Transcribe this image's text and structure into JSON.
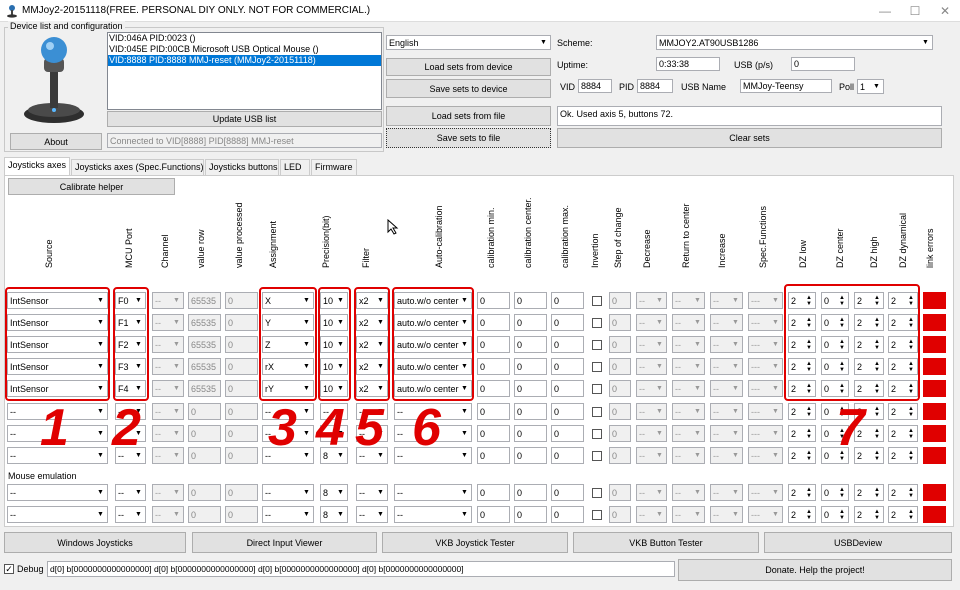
{
  "window": {
    "title": "MMJoy2-20151118(FREE. PERSONAL DIY ONLY. NOT FOR COMMERCIAL.)",
    "min": "—",
    "max": "☐",
    "close": "✕"
  },
  "device_group": {
    "label": "Device list and configuration",
    "devices": [
      "VID:046A PID:0023 ()",
      "VID:045E PID:00CB Microsoft USB Optical Mouse ()",
      "VID:8888 PID:8888 MMJ-reset (MMJoy2-20151118)"
    ],
    "selected": 2,
    "update_usb": "Update USB list",
    "about": "About",
    "status": "Connected to VID[8888] PID[8888] MMJ-reset"
  },
  "language": {
    "value": "English"
  },
  "buttons": {
    "load_device": "Load sets from device",
    "save_device": "Save sets to device",
    "load_file": "Load sets from file",
    "save_file": "Save sets to file",
    "clear": "Clear sets"
  },
  "scheme": {
    "label": "Scheme:",
    "value": "MMJOY2.AT90USB1286"
  },
  "uptime": {
    "label": "Uptime:",
    "value": "0:33:38"
  },
  "usbps": {
    "label": "USB (p/s)",
    "value": "0"
  },
  "vid": {
    "label": "VID",
    "value": "8884"
  },
  "pid": {
    "label": "PID",
    "value": "8884"
  },
  "usbname": {
    "label": "USB Name",
    "value": "MMJoy-Teensy"
  },
  "poll": {
    "label": "Poll",
    "value": "1"
  },
  "info": "Ok. Used axis  5, buttons 72.",
  "tabs": [
    "Joysticks axes",
    "Joysticks axes (Spec.Functions)",
    "Joysticks buttons",
    "LED",
    "Firmware"
  ],
  "calibrate": "Calibrate helper",
  "headers": [
    "Source",
    "MCU Port",
    "Channel",
    "value row",
    "value processed",
    "Assignment",
    "Precision(bit)",
    "Filter",
    "Auto-calibration",
    "calibration min.",
    "calibration center.",
    "calibration max.",
    "Invertion",
    "Step of change",
    "Decrease",
    "Return to center",
    "Increase",
    "Spec.Functions",
    "DZ low",
    "DZ center",
    "DZ high",
    "DZ dynamical",
    "link errors"
  ],
  "rows": [
    {
      "source": "IntSensor",
      "port": "F0",
      "channel": "--",
      "raw": "65535",
      "proc": "0",
      "assign": "X",
      "prec": "10",
      "filter": "x2",
      "auto": "auto.w/o center",
      "cmin": "0",
      "ccen": "0",
      "cmax": "0",
      "step": "0",
      "dec": "--",
      "ret": "--",
      "inc": "--",
      "spec": "---",
      "dzl": "2",
      "dzc": "0",
      "dzh": "2",
      "dzd": "2"
    },
    {
      "source": "IntSensor",
      "port": "F1",
      "channel": "--",
      "raw": "65535",
      "proc": "0",
      "assign": "Y",
      "prec": "10",
      "filter": "x2",
      "auto": "auto.w/o center",
      "cmin": "0",
      "ccen": "0",
      "cmax": "0",
      "step": "0",
      "dec": "--",
      "ret": "--",
      "inc": "--",
      "spec": "---",
      "dzl": "2",
      "dzc": "0",
      "dzh": "2",
      "dzd": "2"
    },
    {
      "source": "IntSensor",
      "port": "F2",
      "channel": "--",
      "raw": "65535",
      "proc": "0",
      "assign": "Z",
      "prec": "10",
      "filter": "x2",
      "auto": "auto.w/o center",
      "cmin": "0",
      "ccen": "0",
      "cmax": "0",
      "step": "0",
      "dec": "--",
      "ret": "--",
      "inc": "--",
      "spec": "---",
      "dzl": "2",
      "dzc": "0",
      "dzh": "2",
      "dzd": "2"
    },
    {
      "source": "IntSensor",
      "port": "F3",
      "channel": "--",
      "raw": "65535",
      "proc": "0",
      "assign": "rX",
      "prec": "10",
      "filter": "x2",
      "auto": "auto.w/o center",
      "cmin": "0",
      "ccen": "0",
      "cmax": "0",
      "step": "0",
      "dec": "--",
      "ret": "--",
      "inc": "--",
      "spec": "---",
      "dzl": "2",
      "dzc": "0",
      "dzh": "2",
      "dzd": "2"
    },
    {
      "source": "IntSensor",
      "port": "F4",
      "channel": "--",
      "raw": "65535",
      "proc": "0",
      "assign": "rY",
      "prec": "10",
      "filter": "x2",
      "auto": "auto.w/o center",
      "cmin": "0",
      "ccen": "0",
      "cmax": "0",
      "step": "0",
      "dec": "--",
      "ret": "--",
      "inc": "--",
      "spec": "---",
      "dzl": "2",
      "dzc": "0",
      "dzh": "2",
      "dzd": "2"
    },
    {
      "source": "--",
      "port": "--",
      "channel": "--",
      "raw": "0",
      "proc": "0",
      "assign": "--",
      "prec": "--",
      "filter": "--",
      "auto": "--",
      "cmin": "0",
      "ccen": "0",
      "cmax": "0",
      "step": "0",
      "dec": "--",
      "ret": "--",
      "inc": "--",
      "spec": "---",
      "dzl": "2",
      "dzc": "0",
      "dzh": "2",
      "dzd": "2"
    },
    {
      "source": "--",
      "port": "--",
      "channel": "--",
      "raw": "0",
      "proc": "0",
      "assign": "--",
      "prec": "--",
      "filter": "--",
      "auto": "--",
      "cmin": "0",
      "ccen": "0",
      "cmax": "0",
      "step": "0",
      "dec": "--",
      "ret": "--",
      "inc": "--",
      "spec": "---",
      "dzl": "2",
      "dzc": "0",
      "dzh": "2",
      "dzd": "2"
    },
    {
      "source": "--",
      "port": "--",
      "channel": "--",
      "raw": "0",
      "proc": "0",
      "assign": "--",
      "prec": "8",
      "filter": "--",
      "auto": "--",
      "cmin": "0",
      "ccen": "0",
      "cmax": "0",
      "step": "0",
      "dec": "--",
      "ret": "--",
      "inc": "--",
      "spec": "---",
      "dzl": "2",
      "dzc": "0",
      "dzh": "2",
      "dzd": "2"
    }
  ],
  "mouse_label": "Mouse emulation",
  "mouse_rows": [
    {
      "source": "--",
      "port": "--",
      "channel": "--",
      "raw": "0",
      "proc": "0",
      "assign": "--",
      "prec": "8",
      "filter": "--",
      "auto": "--",
      "cmin": "0",
      "ccen": "0",
      "cmax": "0",
      "step": "0",
      "dec": "--",
      "ret": "--",
      "inc": "--",
      "spec": "---",
      "dzl": "2",
      "dzc": "0",
      "dzh": "2",
      "dzd": "2"
    },
    {
      "source": "--",
      "port": "--",
      "channel": "--",
      "raw": "0",
      "proc": "0",
      "assign": "--",
      "prec": "8",
      "filter": "--",
      "auto": "--",
      "cmin": "0",
      "ccen": "0",
      "cmax": "0",
      "step": "0",
      "dec": "--",
      "ret": "--",
      "inc": "--",
      "spec": "---",
      "dzl": "2",
      "dzc": "0",
      "dzh": "2",
      "dzd": "2"
    }
  ],
  "annotations": [
    "1",
    "2",
    "3",
    "4",
    "5",
    "6",
    "7"
  ],
  "bottom_buttons": [
    "Windows Joysticks",
    "Direct Input Viewer",
    "VKB Joystick Tester",
    "VKB Button Tester",
    "USBDeview"
  ],
  "debug": {
    "label": "Debug",
    "value": "d[0] b[0000000000000000]   d[0] b[0000000000000000]   d[0] b[0000000000000000]   d[0] b[0000000000000000]"
  },
  "donate": "Donate. Help the project!",
  "colors": {
    "error": "#e00000",
    "annotation": "#e00000",
    "selection": "#0078d7"
  }
}
